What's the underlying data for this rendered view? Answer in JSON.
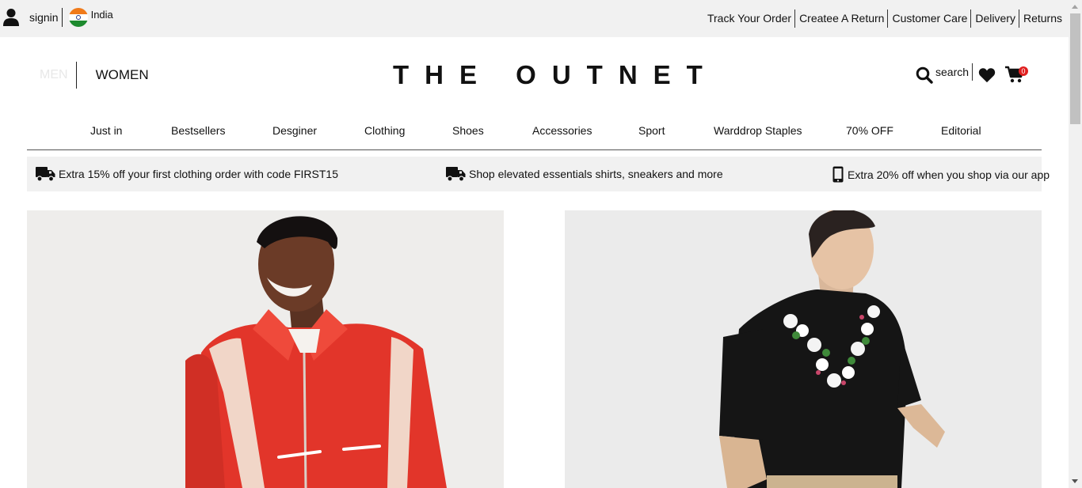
{
  "topbar": {
    "signin": "signin",
    "country": "India",
    "links": [
      "Track Your Order",
      "Createe A Return",
      "Customer Care",
      "Delivery",
      "Returns"
    ]
  },
  "header": {
    "men": "MEN",
    "women": "WOMEN",
    "logo": "THE OUTNET",
    "search": "search",
    "cart_count": "0"
  },
  "nav": {
    "items": [
      "Just in",
      "Bestsellers",
      "Desginer",
      "Clothing",
      "Shoes",
      "Accessories",
      "Sport",
      "Warddrop Staples",
      "70% OFF",
      "Editorial"
    ]
  },
  "promos": [
    {
      "icon": "truck-icon",
      "text": "Extra 15% off your first clothing order with code FIRST15"
    },
    {
      "icon": "truck-icon",
      "text": "Shop elevated essentials shirts, sneakers and more"
    },
    {
      "icon": "phone-icon",
      "text": "Extra 20% off when you shop via our app"
    }
  ],
  "colors": {
    "topbar_bg": "#f1f1f1",
    "badge": "#e01f1f",
    "men_inactive": "#e8e8e8"
  }
}
